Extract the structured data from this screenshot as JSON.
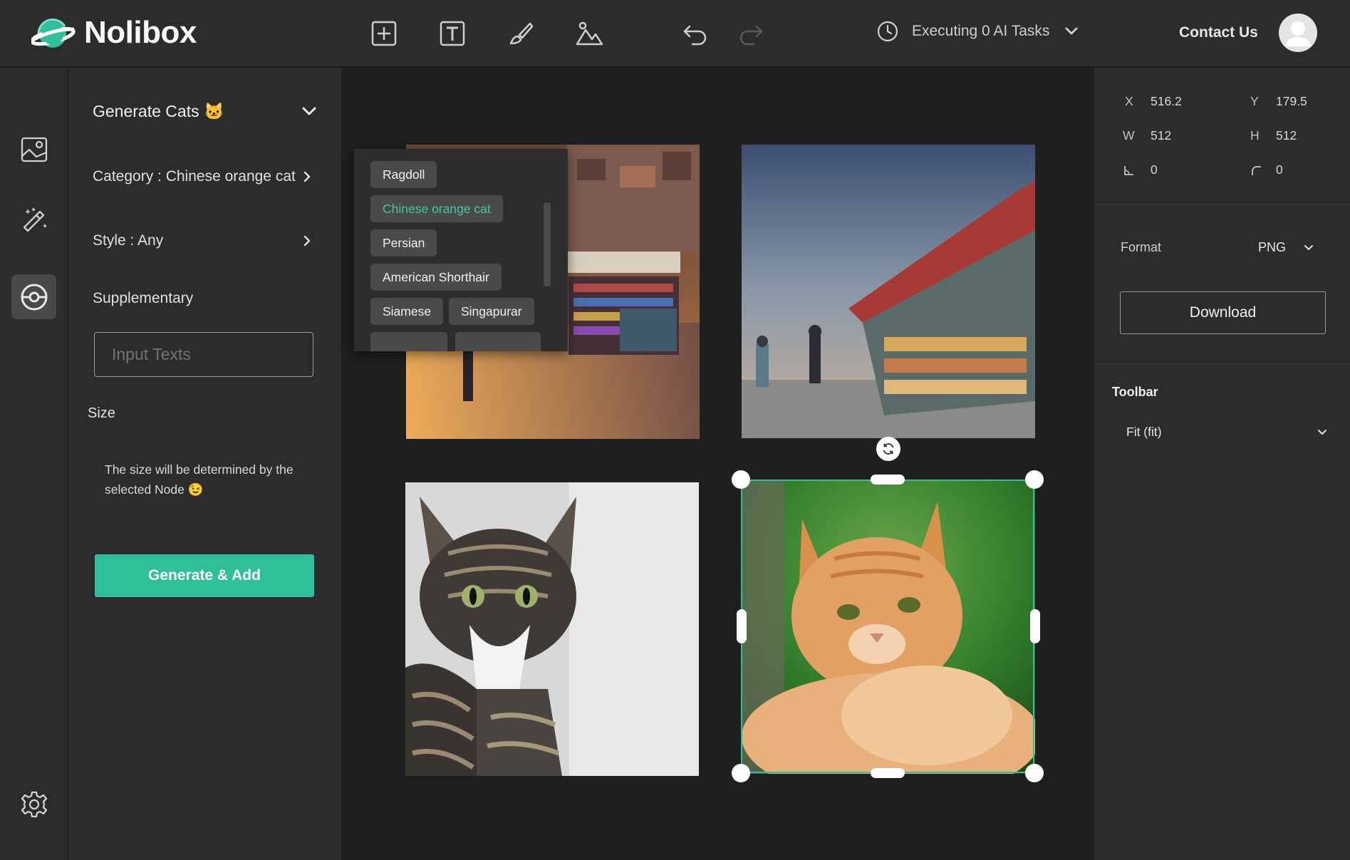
{
  "header": {
    "logo_text": "Nolibox",
    "tasks_label": "Executing 0 AI Tasks",
    "contact_label": "Contact Us",
    "tools": [
      "add-node",
      "text-node",
      "brush",
      "image-node"
    ],
    "undo": "undo",
    "redo": "redo"
  },
  "rail": {
    "items": [
      "image-icon",
      "magic-wand-icon",
      "target-icon"
    ],
    "active": "target-icon",
    "settings": "gear-icon"
  },
  "left_panel": {
    "title": "Generate Cats 🐱",
    "category": "Category : Chinese orange cat",
    "style": "Style : Any",
    "supplementary": "Supplementary",
    "input_placeholder": "Input Texts",
    "size_label": "Size",
    "size_desc": "The size will be determined by the selected Node 😉",
    "generate_button": "Generate & Add"
  },
  "category_popup": {
    "options": [
      "Ragdoll",
      "Chinese orange cat",
      "Persian",
      "American Shorthair",
      "Siamese",
      "Singapurar"
    ],
    "selected": "Chinese orange cat"
  },
  "right_panel": {
    "x_label": "X",
    "x_value": "516.2",
    "y_label": "Y",
    "y_value": "179.5",
    "w_label": "W",
    "w_value": "512",
    "h_label": "H",
    "h_value": "512",
    "skew_value": "0",
    "radius_value": "0",
    "format_label": "Format",
    "format_value": "PNG",
    "download_label": "Download",
    "toolbar_label": "Toolbar",
    "toolbar_value": "Fit (fit)"
  },
  "colors": {
    "accent": "#2fbf9a",
    "panel": "#2c2c2c",
    "canvas": "#1f1f1f"
  }
}
